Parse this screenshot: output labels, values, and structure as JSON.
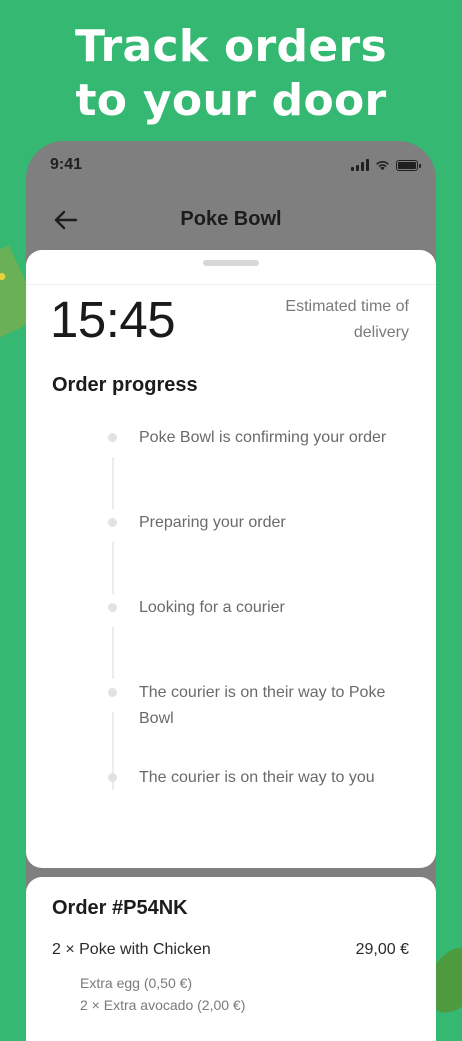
{
  "headline": "Track orders to your door",
  "status_bar": {
    "time": "9:41"
  },
  "nav": {
    "title": "Poke Bowl"
  },
  "eta": {
    "time": "15:45",
    "label": "Estimated time of delivery"
  },
  "progress": {
    "title": "Order progress",
    "steps": [
      {
        "label": "Poke Bowl is confirming your order"
      },
      {
        "label": "Preparing your order"
      },
      {
        "label": "Looking for a courier"
      },
      {
        "label": "The courier is on their way to Poke Bowl"
      },
      {
        "label": "The courier is on their way to you"
      }
    ]
  },
  "order": {
    "title": "Order #P54NK",
    "items": [
      {
        "qty_name": "2 × Poke with Chicken",
        "price": "29,00 €",
        "extras": [
          "Extra egg (0,50 €)",
          "2 × Extra avocado (2,00 €)"
        ]
      }
    ]
  }
}
